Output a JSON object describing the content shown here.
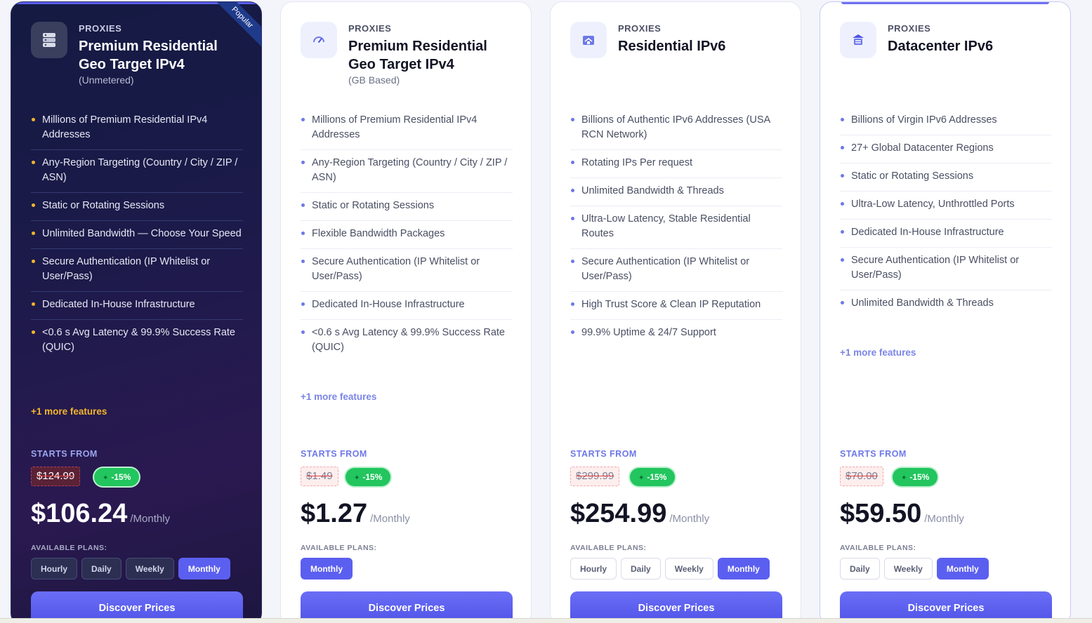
{
  "cards": [
    {
      "kicker": "PROXIES",
      "title": "Premium Residential Geo Target IPv4",
      "subtitle": "(Unmetered)",
      "ribbon": "Popular",
      "icon": "server-icon",
      "features": [
        "Millions of Premium Residential IPv4 Addresses",
        "Any-Region Targeting (Country / City / ZIP / ASN)",
        "Static or Rotating Sessions",
        "Unlimited Bandwidth — Choose Your Speed",
        "Secure Authentication (IP Whitelist or User/Pass)",
        "Dedicated In-House Infrastructure",
        "<0.6 s Avg Latency & 99.9% Success Rate (QUIC)"
      ],
      "more": "+1 more features",
      "starts_from": "STARTS FROM",
      "old_price": "$124.99",
      "discount": "-15%",
      "price": "$106.24",
      "period": "/Monthly",
      "plans_label": "AVAILABLE PLANS:",
      "plans": [
        "Hourly",
        "Daily",
        "Weekly",
        "Monthly"
      ],
      "active_plan": "Monthly",
      "cta": "Discover Prices"
    },
    {
      "kicker": "PROXIES",
      "title": "Premium Residential Geo Target IPv4",
      "subtitle": "(GB Based)",
      "icon": "speedometer-icon",
      "features": [
        "Millions of Premium Residential IPv4 Addresses",
        "Any-Region Targeting (Country / City / ZIP / ASN)",
        "Static or Rotating Sessions",
        "Flexible Bandwidth Packages",
        "Secure Authentication (IP Whitelist or User/Pass)",
        "Dedicated In-House Infrastructure",
        "<0.6 s Avg Latency & 99.9% Success Rate (QUIC)"
      ],
      "more": "+1 more features",
      "starts_from": "STARTS FROM",
      "old_price": "$1.49",
      "discount": "-15%",
      "price": "$1.27",
      "period": "/Monthly",
      "plans_label": "AVAILABLE PLANS:",
      "plans": [
        "Monthly"
      ],
      "active_plan": "Monthly",
      "cta": "Discover Prices"
    },
    {
      "kicker": "PROXIES",
      "title": "Residential IPv6",
      "subtitle": "",
      "icon": "house-network-icon",
      "features": [
        "Billions of Authentic IPv6 Addresses (USA RCN Network)",
        "Rotating IPs Per request",
        "Unlimited Bandwidth & Threads",
        "Ultra-Low Latency, Stable Residential Routes",
        "Secure Authentication (IP Whitelist or User/Pass)",
        "High Trust Score & Clean IP Reputation",
        "99.9% Uptime & 24/7 Support"
      ],
      "more": "",
      "starts_from": "STARTS FROM",
      "old_price": "$299.99",
      "discount": "-15%",
      "price": "$254.99",
      "period": "/Monthly",
      "plans_label": "AVAILABLE PLANS:",
      "plans": [
        "Hourly",
        "Daily",
        "Weekly",
        "Monthly"
      ],
      "active_plan": "Monthly",
      "cta": "Discover Prices"
    },
    {
      "kicker": "PROXIES",
      "title": "Datacenter IPv6",
      "subtitle": "",
      "icon": "datacenter-icon",
      "features": [
        "Billions of Virgin IPv6 Addresses",
        "27+ Global Datacenter Regions",
        "Static or Rotating Sessions",
        "Ultra-Low Latency, Unthrottled Ports",
        "Dedicated In-House Infrastructure",
        "Secure Authentication (IP Whitelist or User/Pass)",
        "Unlimited Bandwidth & Threads"
      ],
      "more": "+1 more features",
      "starts_from": "STARTS FROM",
      "old_price": "$70.00",
      "discount": "-15%",
      "price": "$59.50",
      "period": "/Monthly",
      "plans_label": "AVAILABLE PLANS:",
      "plans": [
        "Daily",
        "Weekly",
        "Monthly"
      ],
      "active_plan": "Monthly",
      "cta": "Discover Prices"
    }
  ],
  "colors": {
    "accent": "#5b5ff0",
    "dark_card": "#1c1a4a",
    "discount_green": "#22c55e",
    "bullet_gold": "#f5b52b",
    "bullet_blue": "#6d78e8"
  }
}
